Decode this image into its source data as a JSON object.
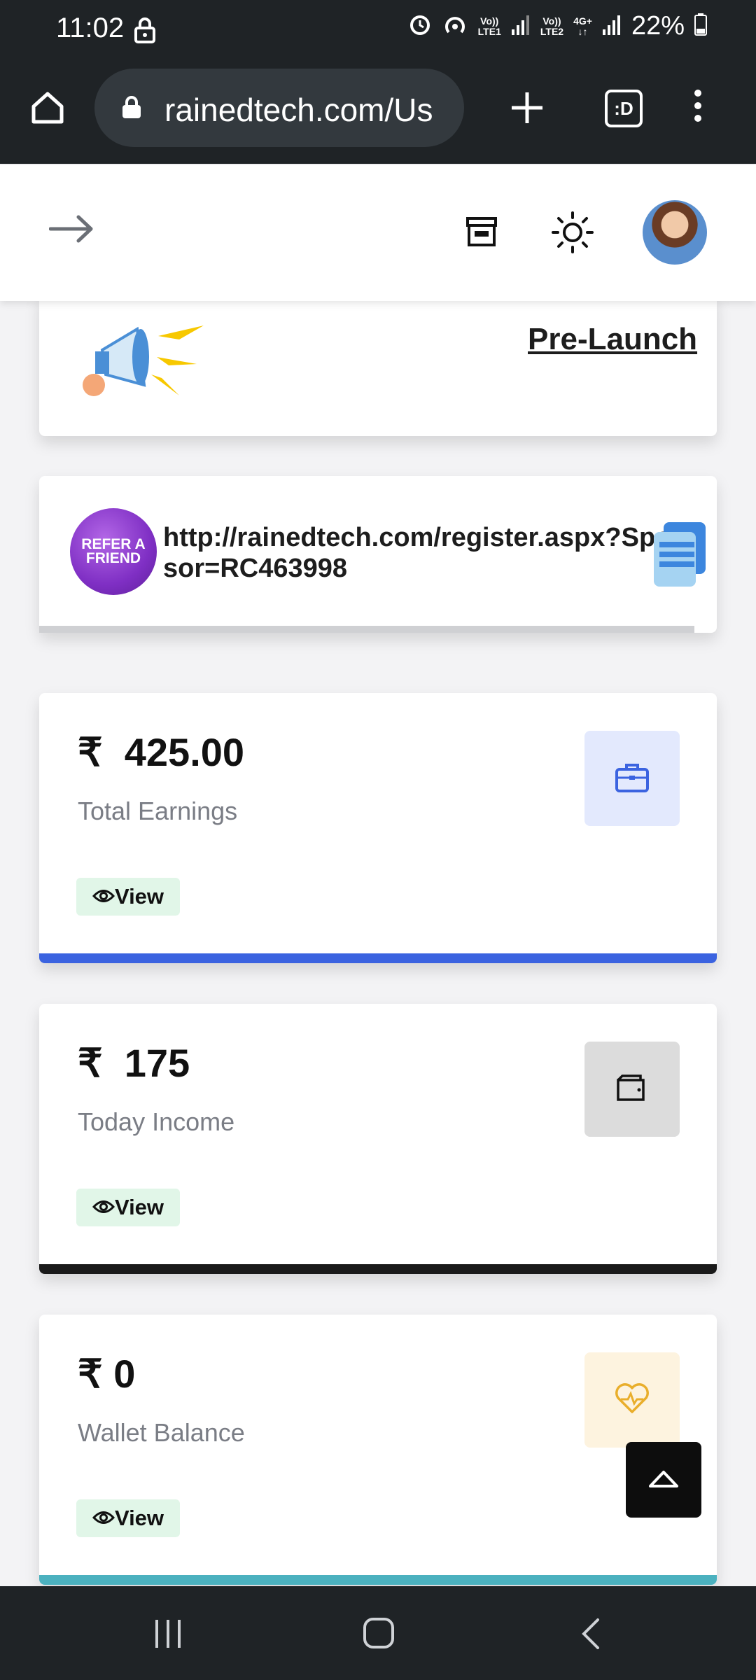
{
  "status_bar": {
    "time": "11:02",
    "sim1_label_top": "Vo))",
    "sim1_label_bottom": "LTE1",
    "sim2_label_top": "Vo))",
    "sim2_label_bottom": "LTE2",
    "network": "4G+",
    "battery": "22%"
  },
  "browser": {
    "url": "rainedtech.com/Us",
    "tab_icon_text": ":D"
  },
  "promo": {
    "heading": "Pre-Launch"
  },
  "referral": {
    "badge_line1": "REFER A",
    "badge_line2": "FRIEND",
    "link": "http://rainedtech.com/register.aspx?Sponsor=RC463998"
  },
  "stats": [
    {
      "currency": "₹",
      "value": "425.00",
      "label": "Total Earnings",
      "view_label": "View",
      "icon": "briefcase-icon",
      "icon_bg": "#e3e9fd",
      "icon_color": "#3b63e0",
      "bar_color": "#3b63e0"
    },
    {
      "currency": "₹",
      "value": "175",
      "label": "Today Income",
      "view_label": "View",
      "icon": "wallet-icon",
      "icon_bg": "#dcdcdc",
      "icon_color": "#111111",
      "bar_color": "#1a1a1a"
    },
    {
      "currency": "₹",
      "value": "0",
      "label": "Wallet Balance",
      "view_label": "View",
      "icon": "heart-pulse-icon",
      "icon_bg": "#fdf3df",
      "icon_color": "#e9ae2b",
      "bar_color": "#4bb1bf"
    }
  ]
}
